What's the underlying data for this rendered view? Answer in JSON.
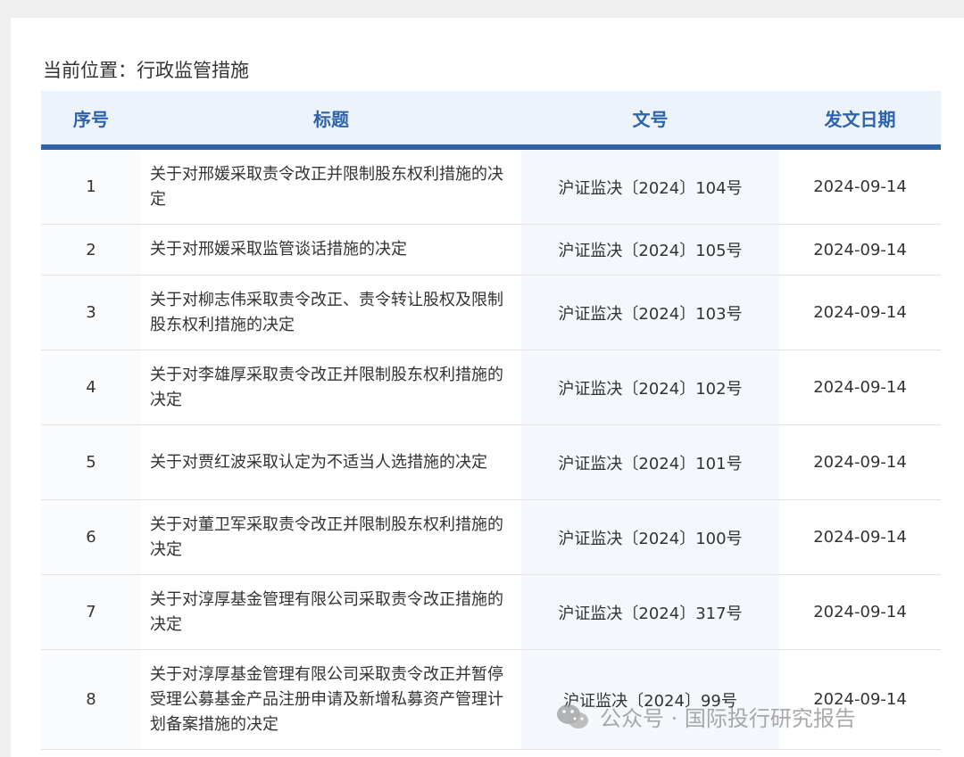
{
  "breadcrumb": "当前位置：行政监管措施",
  "table": {
    "headers": {
      "index": "序号",
      "title": "标题",
      "doc_no": "文号",
      "date": "发文日期"
    },
    "rows": [
      {
        "index": "1",
        "title": "关于对邢媛采取责令改正并限制股东权利措施的决定",
        "doc_no": "沪证监决〔2024〕104号",
        "date": "2024-09-14"
      },
      {
        "index": "2",
        "title": "关于对邢媛采取监管谈话措施的决定",
        "doc_no": "沪证监决〔2024〕105号",
        "date": "2024-09-14"
      },
      {
        "index": "3",
        "title": "关于对柳志伟采取责令改正、责令转让股权及限制股东权利措施的决定",
        "doc_no": "沪证监决〔2024〕103号",
        "date": "2024-09-14"
      },
      {
        "index": "4",
        "title": "关于对李雄厚采取责令改正并限制股东权利措施的决定",
        "doc_no": "沪证监决〔2024〕102号",
        "date": "2024-09-14"
      },
      {
        "index": "5",
        "title": "关于对贾红波采取认定为不适当人选措施的决定",
        "doc_no": "沪证监决〔2024〕101号",
        "date": "2024-09-14"
      },
      {
        "index": "6",
        "title": "关于对董卫军采取责令改正并限制股东权利措施的决定",
        "doc_no": "沪证监决〔2024〕100号",
        "date": "2024-09-14"
      },
      {
        "index": "7",
        "title": "关于对淳厚基金管理有限公司采取责令改正措施的决定",
        "doc_no": "沪证监决〔2024〕317号",
        "date": "2024-09-14"
      },
      {
        "index": "8",
        "title": "关于对淳厚基金管理有限公司采取责令改正并暂停受理公募基金产品注册申请及新增私募资产管理计划备案措施的决定",
        "doc_no": "沪证监决〔2024〕99号",
        "date": "2024-09-14"
      }
    ]
  },
  "watermark": {
    "text": "公众号 · 国际投行研究报告",
    "icon": "wechat-icon"
  }
}
